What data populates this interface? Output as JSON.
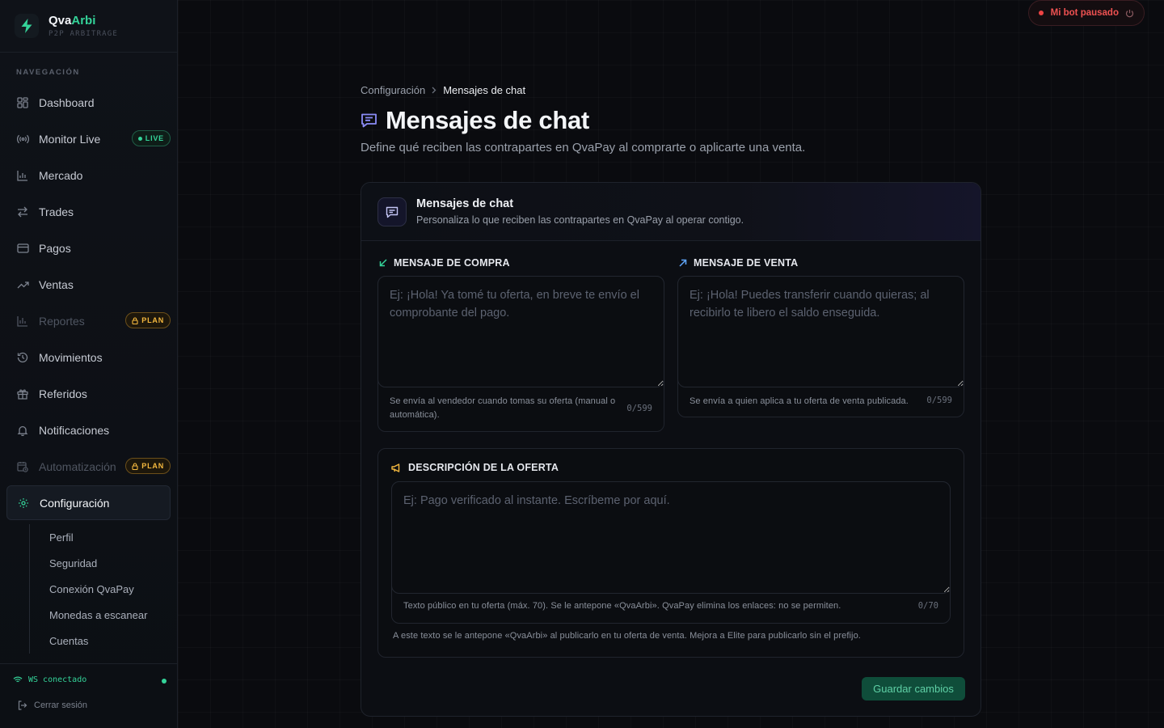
{
  "brand": {
    "name_part1": "Qva",
    "name_part2": "Arbi",
    "subtitle": "P2P ARBITRAGE"
  },
  "sidebar": {
    "section_label": "NAVEGACIÓN",
    "items": [
      {
        "label": "Dashboard",
        "icon": "grid-icon"
      },
      {
        "label": "Monitor Live",
        "icon": "broadcast-icon",
        "badge": "LIVE"
      },
      {
        "label": "Mercado",
        "icon": "chart-icon"
      },
      {
        "label": "Trades",
        "icon": "arrows-swap-icon"
      },
      {
        "label": "Pagos",
        "icon": "credit-card-icon"
      },
      {
        "label": "Ventas",
        "icon": "trending-up-icon"
      },
      {
        "label": "Reportes",
        "icon": "bar-chart-icon",
        "badge": "PLAN",
        "disabled": true
      },
      {
        "label": "Movimientos",
        "icon": "history-icon"
      },
      {
        "label": "Referidos",
        "icon": "gift-icon"
      },
      {
        "label": "Notificaciones",
        "icon": "bell-icon"
      },
      {
        "label": "Automatización",
        "icon": "calendar-clock-icon",
        "badge": "PLAN",
        "disabled": true
      },
      {
        "label": "Configuración",
        "icon": "gear-icon",
        "active": true
      }
    ],
    "subitems": [
      "Perfil",
      "Seguridad",
      "Conexión QvaPay",
      "Monedas a escanear",
      "Cuentas"
    ],
    "ws_status": "WS conectado",
    "logout": "Cerrar sesión"
  },
  "top": {
    "bot_status": "Mi bot pausado"
  },
  "breadcrumb": {
    "parent": "Configuración",
    "current": "Mensajes de chat"
  },
  "page": {
    "title": "Mensajes de chat",
    "description": "Define qué reciben las contrapartes en QvaPay al comprarte o aplicarte una venta."
  },
  "card": {
    "title": "Mensajes de chat",
    "subtitle": "Personaliza lo que reciben las contrapartes en QvaPay al operar contigo.",
    "buy": {
      "label": "MENSAJE DE COMPRA",
      "value": "",
      "placeholder": "Ej: ¡Hola! Ya tomé tu oferta, en breve te envío el comprobante del pago.",
      "hint": "Se envía al vendedor cuando tomas su oferta (manual o automática).",
      "count": "0/599"
    },
    "sell": {
      "label": "MENSAJE DE VENTA",
      "value": "",
      "placeholder": "Ej: ¡Hola! Puedes transferir cuando quieras; al recibirlo te libero el saldo enseguida.",
      "hint": "Se envía a quien aplica a tu oferta de venta publicada.",
      "count": "0/599"
    },
    "offer": {
      "label": "DESCRIPCIÓN DE LA OFERTA",
      "value": "",
      "placeholder": "Ej: Pago verificado al instante. Escríbeme por aquí.",
      "hint": "Texto público en tu oferta (máx. 70). Se le antepone «QvaArbi». QvaPay elimina los enlaces: no se permiten.",
      "count": "0/70",
      "note": "A este texto se le antepone «QvaArbi» al publicarlo en tu oferta de venta. Mejora a Elite para publicarlo sin el prefijo."
    },
    "save_label": "Guardar cambios"
  },
  "colors": {
    "accent_green": "#34d399",
    "plan_amber": "#f5b93f",
    "danger": "#ef4444",
    "indigo": "#8b8cf6"
  }
}
